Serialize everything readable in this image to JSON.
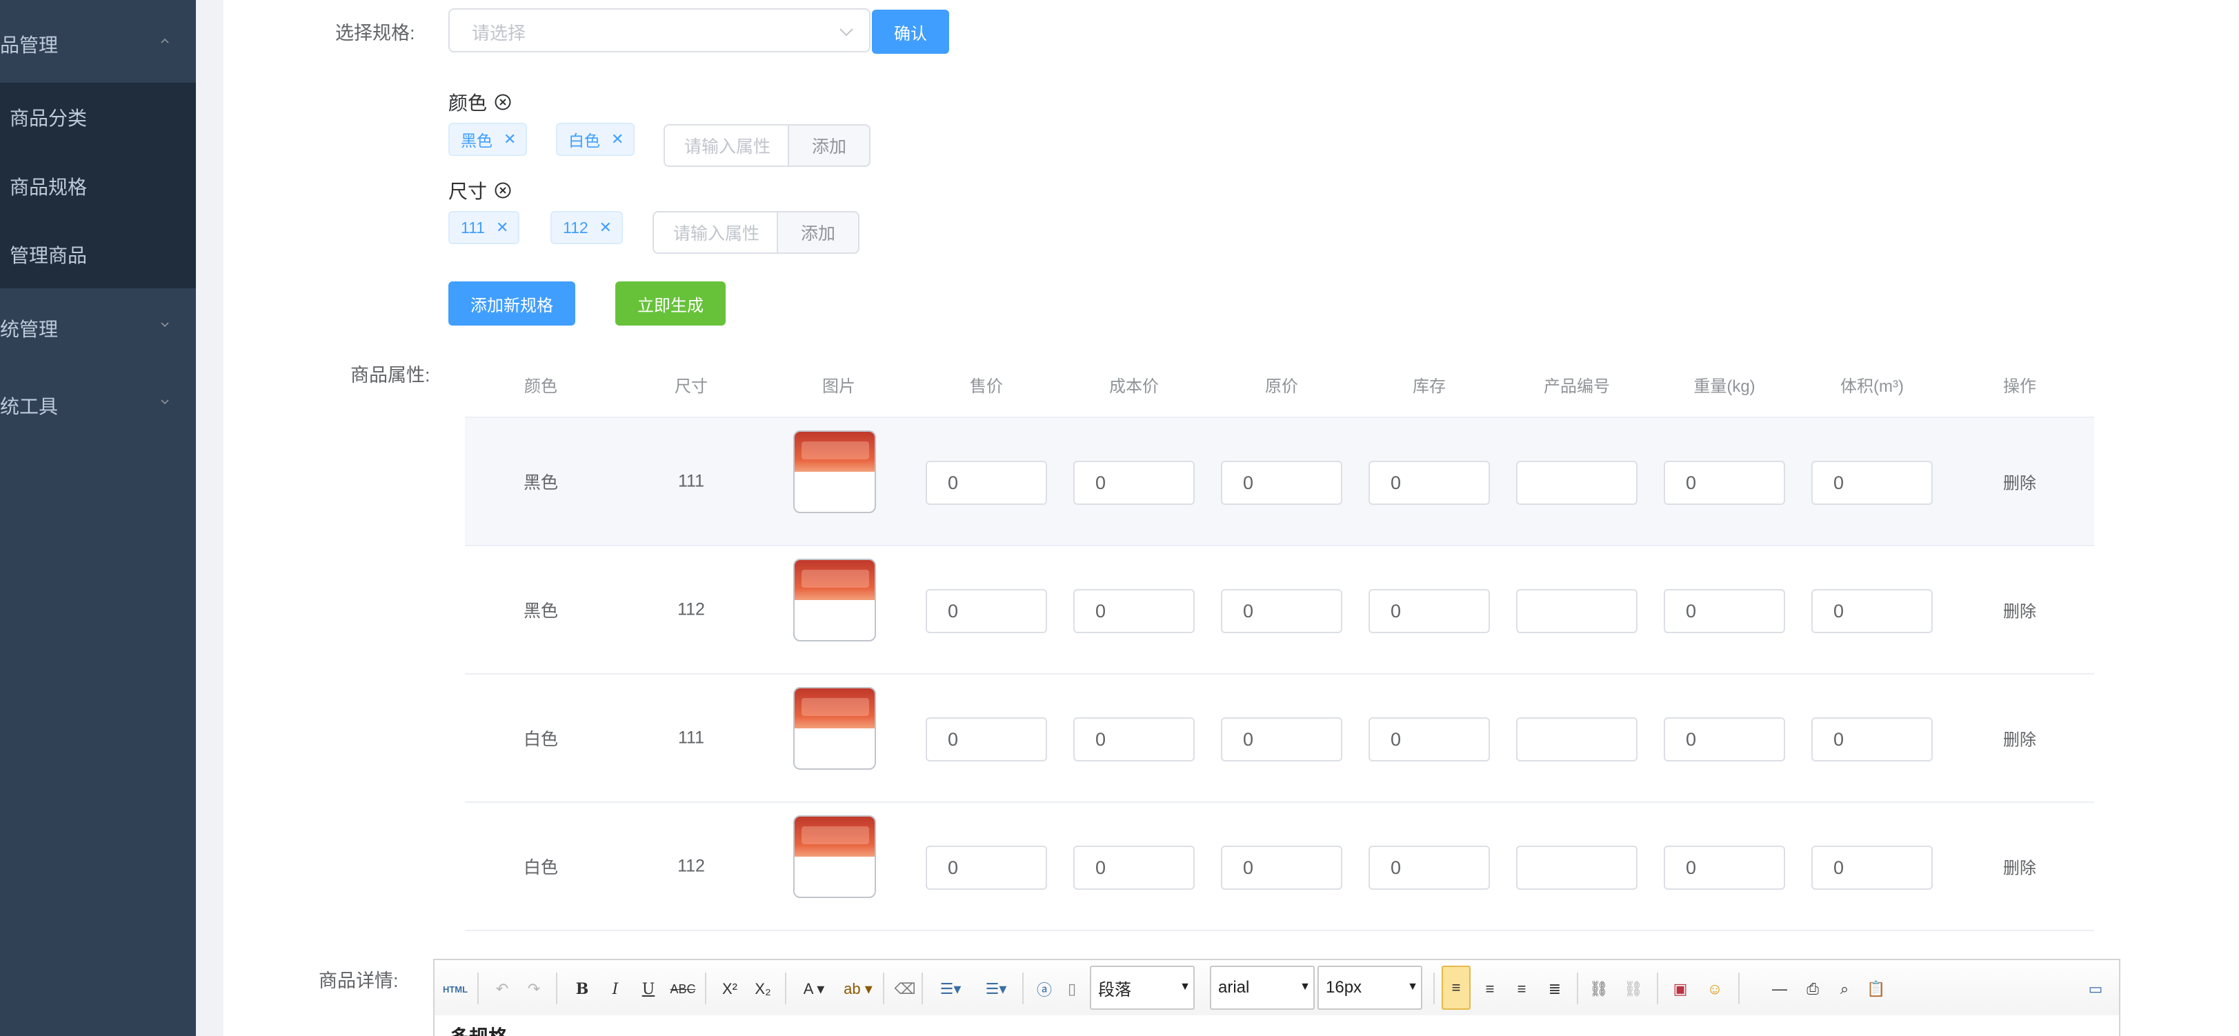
{
  "sidebar": {
    "groups": [
      {
        "label": "品管理",
        "expanded": true
      },
      {
        "label": "统管理",
        "expanded": false
      },
      {
        "label": "统工具",
        "expanded": false
      }
    ],
    "items": [
      {
        "label": "商品分类"
      },
      {
        "label": "商品规格"
      },
      {
        "label": "管理商品"
      }
    ]
  },
  "spec_select": {
    "label": "选择规格:",
    "placeholder": "请选择",
    "confirm_label": "确认"
  },
  "specs": [
    {
      "name": "颜色",
      "values": [
        "黑色",
        "白色"
      ],
      "input_placeholder": "请输入属性",
      "add_label": "添加"
    },
    {
      "name": "尺寸",
      "values": [
        "111",
        "112"
      ],
      "input_placeholder": "请输入属性",
      "add_label": "添加"
    }
  ],
  "actions": {
    "add_spec_label": "添加新规格",
    "generate_label": "立即生成"
  },
  "attributes": {
    "label": "商品属性:",
    "columns": [
      "颜色",
      "尺寸",
      "图片",
      "售价",
      "成本价",
      "原价",
      "库存",
      "产品编号",
      "重量(kg)",
      "体积(m³)",
      "操作"
    ],
    "rows": [
      {
        "color": "黑色",
        "size": "111",
        "price": "0",
        "cost": "0",
        "original": "0",
        "stock": "0",
        "code": "",
        "weight": "0",
        "volume": "0",
        "action": "删除"
      },
      {
        "color": "黑色",
        "size": "112",
        "price": "0",
        "cost": "0",
        "original": "0",
        "stock": "0",
        "code": "",
        "weight": "0",
        "volume": "0",
        "action": "删除"
      },
      {
        "color": "白色",
        "size": "111",
        "price": "0",
        "cost": "0",
        "original": "0",
        "stock": "0",
        "code": "",
        "weight": "0",
        "volume": "0",
        "action": "删除"
      },
      {
        "color": "白色",
        "size": "112",
        "price": "0",
        "cost": "0",
        "original": "0",
        "stock": "0",
        "code": "",
        "weight": "0",
        "volume": "0",
        "action": "删除"
      }
    ]
  },
  "details": {
    "label": "商品详情:",
    "toolbar": {
      "html_label": "HTML",
      "paragraph": "段落",
      "font": "arial",
      "size": "16px"
    },
    "body_text": "多规格"
  },
  "colors": {
    "sidebar_bg": "#304156",
    "submenu_bg": "#1f2d3d",
    "primary": "#409eff",
    "success": "#67c23a"
  }
}
